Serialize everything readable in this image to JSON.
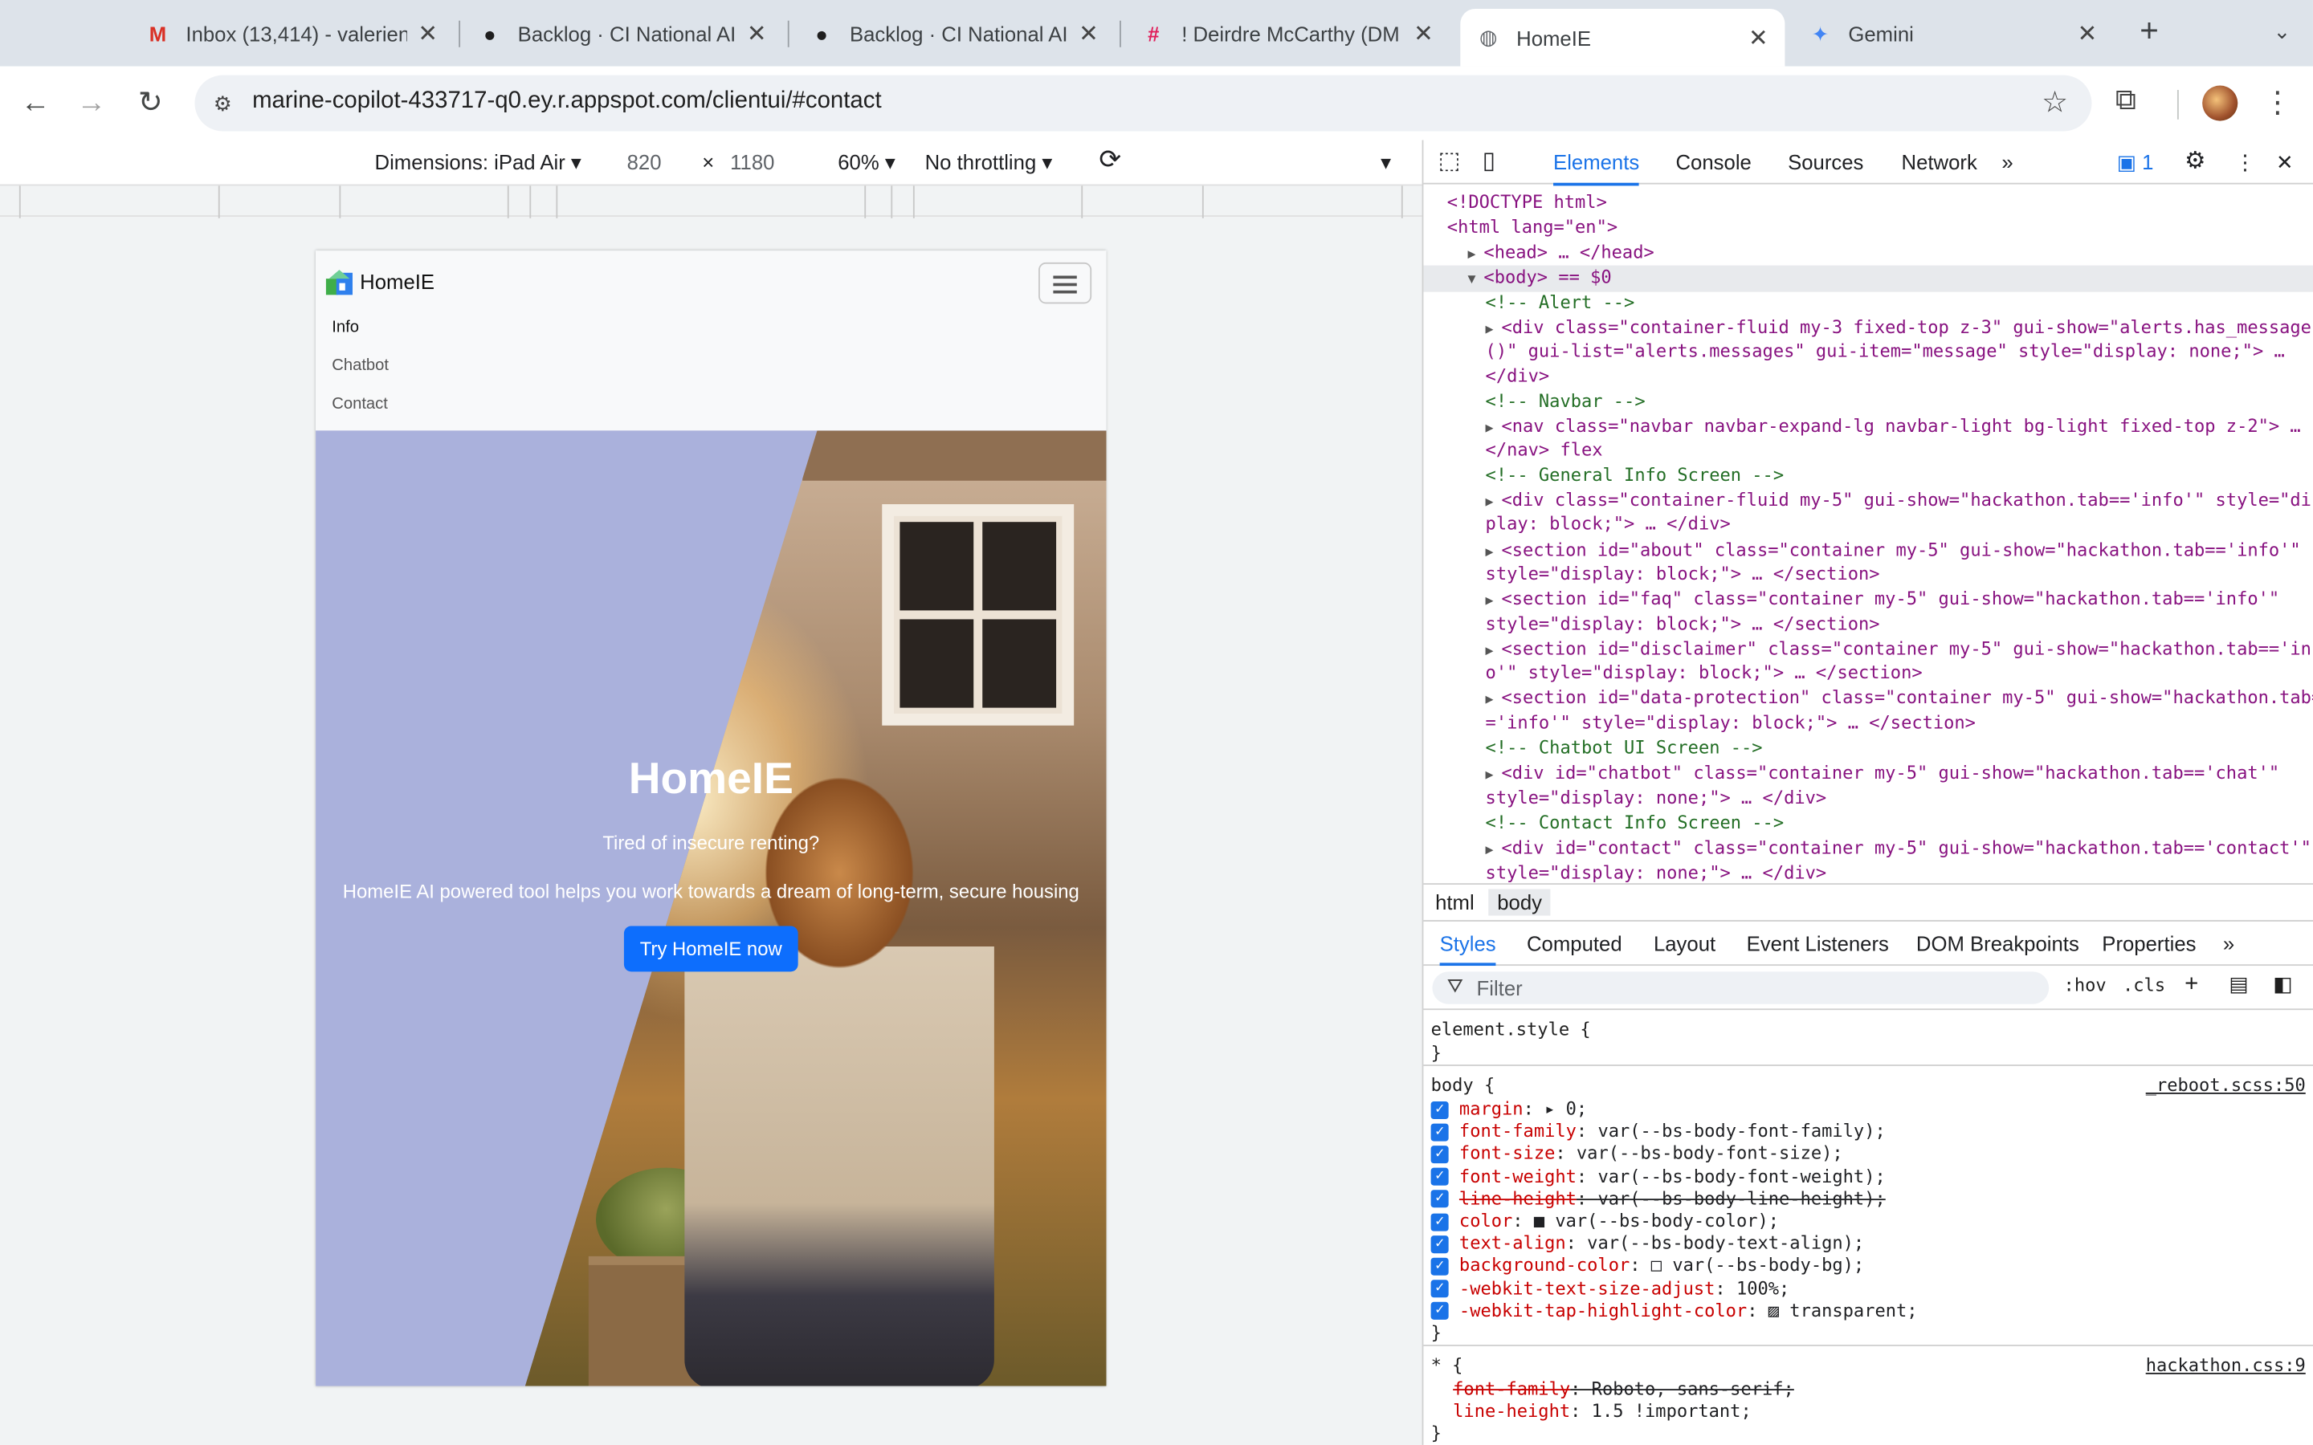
{
  "tabs": [
    {
      "title": "Inbox (13,414) - valerien",
      "icon": "gmail-icon",
      "glyph": "M",
      "color": "#d93025"
    },
    {
      "title": "Backlog · CI National AI",
      "icon": "github-icon",
      "glyph": "●",
      "color": "#1f1f1f"
    },
    {
      "title": "Backlog · CI National AI",
      "icon": "github-icon",
      "glyph": "●",
      "color": "#1f1f1f"
    },
    {
      "title": "! Deirdre McCarthy (DM",
      "icon": "slack-icon",
      "glyph": "#",
      "color": "#e01e5a"
    },
    {
      "title": "HomeIE",
      "icon": "globe-icon",
      "glyph": "◍",
      "color": "#5f6368"
    },
    {
      "title": "Gemini",
      "icon": "gemini-icon",
      "glyph": "✦",
      "color": "#4285f4"
    }
  ],
  "url": "marine-copilot-433717-q0.ey.r.appspot.com/clientui/#contact",
  "device_toolbar": {
    "dimensions": "Dimensions: iPad Air",
    "width": "820",
    "times": "×",
    "height": "1180",
    "zoom": "60%",
    "throttling": "No throttling"
  },
  "app": {
    "brand": "HomeIE",
    "nav": [
      "Info",
      "Chatbot",
      "Contact"
    ],
    "hero_title": "HomeIE",
    "hero_sub": "Tired of insecure renting?",
    "hero_desc": "HomeIE AI powered tool helps you work towards a dream of long-term, secure housing",
    "cta": "Try HomeIE now"
  },
  "devtools": {
    "tabs": [
      "Elements",
      "Console",
      "Sources",
      "Network"
    ],
    "issues_count": "1",
    "breadcrumbs": [
      "html",
      "body"
    ],
    "pane_tabs": [
      "Styles",
      "Computed",
      "Layout",
      "Event Listeners",
      "DOM Breakpoints",
      "Properties"
    ],
    "filter_placeholder": "Filter",
    "hov": ":hov",
    "cls": ".cls",
    "dom_lines": [
      "<!DOCTYPE html>",
      "<html lang=\"en\">",
      "<head> … </head>",
      "<body> == $0",
      "<!-- Alert -->",
      "<div class=\"container-fluid my-3 fixed-top z-3\" gui-show=\"alerts.has_message",
      "()\" gui-list=\"alerts.messages\" gui-item=\"message\" style=\"display: none;\"> …",
      "</div>",
      "<!-- Navbar -->",
      "<nav class=\"navbar navbar-expand-lg navbar-light bg-light fixed-top z-2\"> …",
      "</nav> flex",
      "<!-- General Info Screen -->",
      "<div class=\"container-fluid my-5\" gui-show=\"hackathon.tab=='info'\" style=\"dis",
      "play: block;\"> … </div>",
      "<section id=\"about\" class=\"container my-5\" gui-show=\"hackathon.tab=='info'\"",
      "style=\"display: block;\"> … </section>",
      "<section id=\"faq\" class=\"container my-5\" gui-show=\"hackathon.tab=='info'\"",
      "style=\"display: block;\"> … </section>",
      "<section id=\"disclaimer\" class=\"container my-5\" gui-show=\"hackathon.tab=='inf",
      "o'\" style=\"display: block;\"> … </section>",
      "<section id=\"data-protection\" class=\"container my-5\" gui-show=\"hackathon.tab=",
      "='info'\" style=\"display: block;\"> … </section>",
      "<!-- Chatbot UI Screen -->",
      "<div id=\"chatbot\" class=\"container my-5\" gui-show=\"hackathon.tab=='chat'\"",
      "style=\"display: none;\"> … </div>",
      "<!-- Contact Info Screen -->",
      "<div id=\"contact\" class=\"container my-5\" gui-show=\"hackathon.tab=='contact'\"",
      "style=\"display: none;\"> … </div>"
    ],
    "style_rules": [
      {
        "selector": "element.style {",
        "source": "",
        "props": [],
        "close": "}"
      },
      {
        "selector": "body {",
        "source": "_reboot.scss:50",
        "close": "}",
        "props": [
          {
            "name": "margin",
            "value": "▸ 0;",
            "struck": false
          },
          {
            "name": "font-family",
            "value": "var(--bs-body-font-family);",
            "struck": false
          },
          {
            "name": "font-size",
            "value": "var(--bs-body-font-size);",
            "struck": false
          },
          {
            "name": "font-weight",
            "value": "var(--bs-body-font-weight);",
            "struck": false
          },
          {
            "name": "line-height",
            "value": "var(--bs-body-line-height);",
            "struck": true
          },
          {
            "name": "color",
            "value": "■ var(--bs-body-color);",
            "struck": false
          },
          {
            "name": "text-align",
            "value": "var(--bs-body-text-align);",
            "struck": false
          },
          {
            "name": "background-color",
            "value": "□ var(--bs-body-bg);",
            "struck": false
          },
          {
            "name": "-webkit-text-size-adjust",
            "value": "100%;",
            "struck": false
          },
          {
            "name": "-webkit-tap-highlight-color",
            "value": "▨ transparent;",
            "struck": false
          }
        ]
      },
      {
        "selector": "* {",
        "source": "hackathon.css:9",
        "close": "}",
        "props": [
          {
            "name": "font-family",
            "value": "Roboto, sans-serif;",
            "struck": true
          },
          {
            "name": "line-height",
            "value": "1.5 !important;",
            "struck": false
          }
        ]
      }
    ]
  }
}
